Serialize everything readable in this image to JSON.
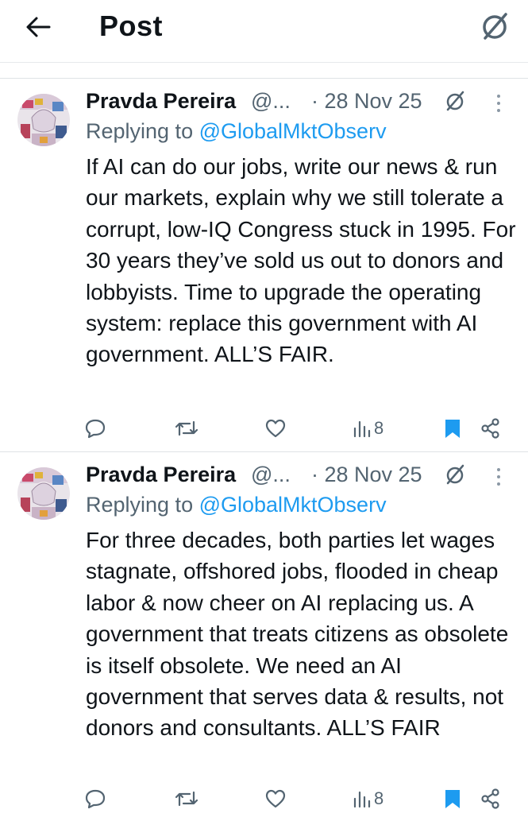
{
  "header": {
    "title": "Post",
    "back_icon": "arrow-left-icon",
    "grok_icon": "grok-icon"
  },
  "posts": [
    {
      "author_name": "Pravda Pereira",
      "handle": "@...",
      "date": "· 28 Nov 25",
      "replying_prefix": "Replying to ",
      "replying_to": "@GlobalMktObserv",
      "text": "If AI can do our jobs, write our news & run our markets, explain why we still tolerate a corrupt, low-IQ Congress stuck in 1995. For 30 years they’ve sold us out to donors and lobbyists. Time to upgrade the operating system: replace this government with AI government. ALL’S FAIR.",
      "views": "8",
      "bookmarked": true
    },
    {
      "author_name": "Pravda Pereira",
      "handle": "@...",
      "date": "· 28 Nov 25",
      "replying_prefix": "Replying to ",
      "replying_to": "@GlobalMktObserv",
      "text": "For three decades, both parties let wages stagnate, offshored jobs, flooded in cheap labor & now cheer on AI replacing us. A government that treats citizens as obsolete is itself obsolete. We need an AI government that serves data & results, not donors and consultants. ALL’S FAIR",
      "views": "8",
      "bookmarked": true
    }
  ],
  "colors": {
    "text": "#0f1419",
    "secondary": "#536471",
    "link": "#1d9bf0",
    "divider": "#dfe3e6"
  }
}
